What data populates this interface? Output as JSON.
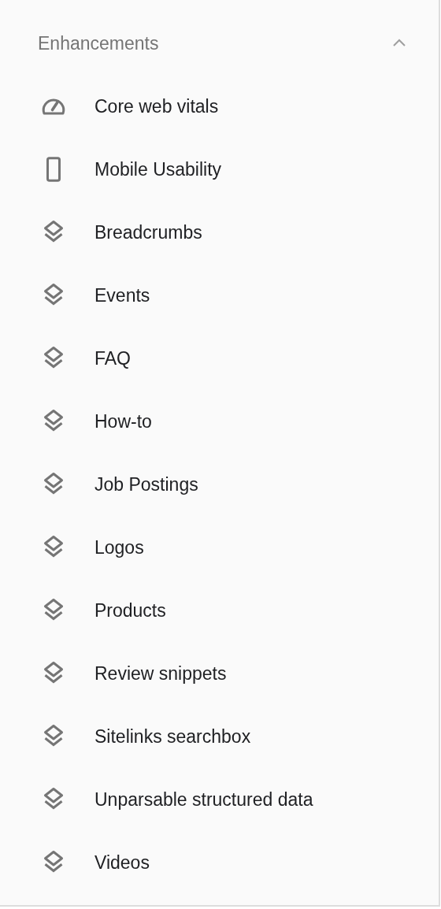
{
  "section": {
    "title": "Enhancements",
    "expanded": true,
    "items": [
      {
        "label": "Core web vitals",
        "kind": "gauge"
      },
      {
        "label": "Mobile Usability",
        "kind": "phone"
      },
      {
        "label": "Breadcrumbs",
        "kind": "layers"
      },
      {
        "label": "Events",
        "kind": "layers"
      },
      {
        "label": "FAQ",
        "kind": "layers"
      },
      {
        "label": "How-to",
        "kind": "layers"
      },
      {
        "label": "Job Postings",
        "kind": "layers"
      },
      {
        "label": "Logos",
        "kind": "layers"
      },
      {
        "label": "Products",
        "kind": "layers"
      },
      {
        "label": "Review snippets",
        "kind": "layers"
      },
      {
        "label": "Sitelinks searchbox",
        "kind": "layers"
      },
      {
        "label": "Unparsable structured data",
        "kind": "layers"
      },
      {
        "label": "Videos",
        "kind": "layers"
      }
    ]
  }
}
